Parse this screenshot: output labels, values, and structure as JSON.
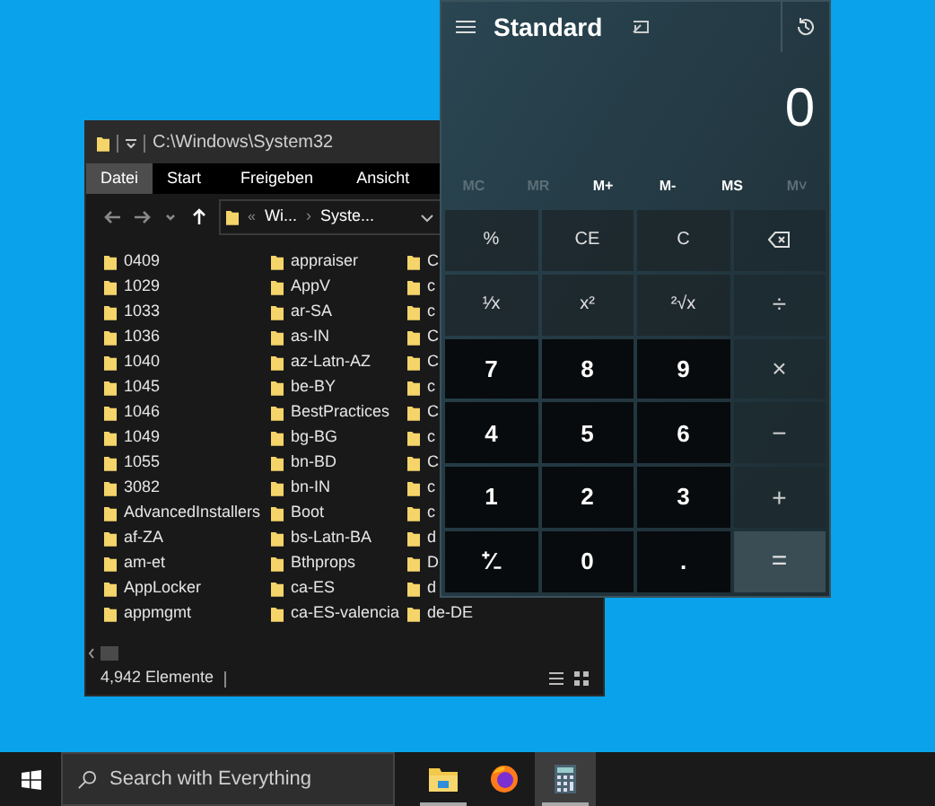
{
  "explorer": {
    "title": "C:\\Windows\\System32",
    "ribbon_tabs": [
      {
        "label": "Datei",
        "selected": true
      },
      {
        "label": "Start",
        "selected": false
      },
      {
        "label": "Freigeben",
        "selected": false
      },
      {
        "label": "Ansicht",
        "selected": false
      }
    ],
    "address": {
      "overflow": "«",
      "segments": [
        "Wi...",
        "Syste..."
      ],
      "separator": "›"
    },
    "columns": [
      [
        "0409",
        "1029",
        "1033",
        "1036",
        "1040",
        "1045",
        "1046",
        "1049",
        "1055",
        "3082",
        "AdvancedInstallers",
        "af-ZA",
        "am-et",
        "AppLocker",
        "appmgmt"
      ],
      [
        "appraiser",
        "AppV",
        "ar-SA",
        "as-IN",
        "az-Latn-AZ",
        "be-BY",
        "BestPractices",
        "bg-BG",
        "bn-BD",
        "bn-IN",
        "Boot",
        "bs-Latn-BA",
        "Bthprops",
        "ca-ES",
        "ca-ES-valencia"
      ],
      [
        "C",
        "c",
        "c",
        "C",
        "C",
        "c",
        "C",
        "c",
        "C",
        "c",
        "c",
        "d",
        "D",
        "d",
        "de-DE"
      ]
    ],
    "status": "4,942 Elemente"
  },
  "calculator": {
    "mode": "Standard",
    "display": "0",
    "memory": [
      {
        "label": "MC",
        "disabled": true
      },
      {
        "label": "MR",
        "disabled": true
      },
      {
        "label": "M+",
        "disabled": false
      },
      {
        "label": "M-",
        "disabled": false
      },
      {
        "label": "MS",
        "disabled": false
      },
      {
        "label": "M˅",
        "disabled": true
      }
    ],
    "keys": [
      {
        "kind": "function",
        "label": "%"
      },
      {
        "kind": "function",
        "label": "CE"
      },
      {
        "kind": "function",
        "label": "C"
      },
      {
        "kind": "backspace"
      },
      {
        "kind": "function",
        "label": "¹⁄x"
      },
      {
        "kind": "function",
        "label": "x²"
      },
      {
        "kind": "function",
        "label": "²√x"
      },
      {
        "kind": "operator",
        "label": "÷"
      },
      {
        "kind": "digit",
        "label": "7"
      },
      {
        "kind": "digit",
        "label": "8"
      },
      {
        "kind": "digit",
        "label": "9"
      },
      {
        "kind": "operator",
        "label": "×"
      },
      {
        "kind": "digit",
        "label": "4"
      },
      {
        "kind": "digit",
        "label": "5"
      },
      {
        "kind": "digit",
        "label": "6"
      },
      {
        "kind": "operator",
        "label": "−"
      },
      {
        "kind": "digit",
        "label": "1"
      },
      {
        "kind": "digit",
        "label": "2"
      },
      {
        "kind": "digit",
        "label": "3"
      },
      {
        "kind": "operator",
        "label": "+"
      },
      {
        "kind": "digit",
        "label": "⁺∕₋"
      },
      {
        "kind": "digit",
        "label": "0"
      },
      {
        "kind": "digit",
        "label": "."
      },
      {
        "kind": "equals",
        "label": "="
      }
    ]
  },
  "taskbar": {
    "search_placeholder": "Search with Everything",
    "apps": [
      {
        "kind": "explorer",
        "running": true,
        "selected": false
      },
      {
        "kind": "firefox",
        "running": false,
        "selected": false
      },
      {
        "kind": "calculator",
        "running": true,
        "selected": true
      }
    ]
  }
}
